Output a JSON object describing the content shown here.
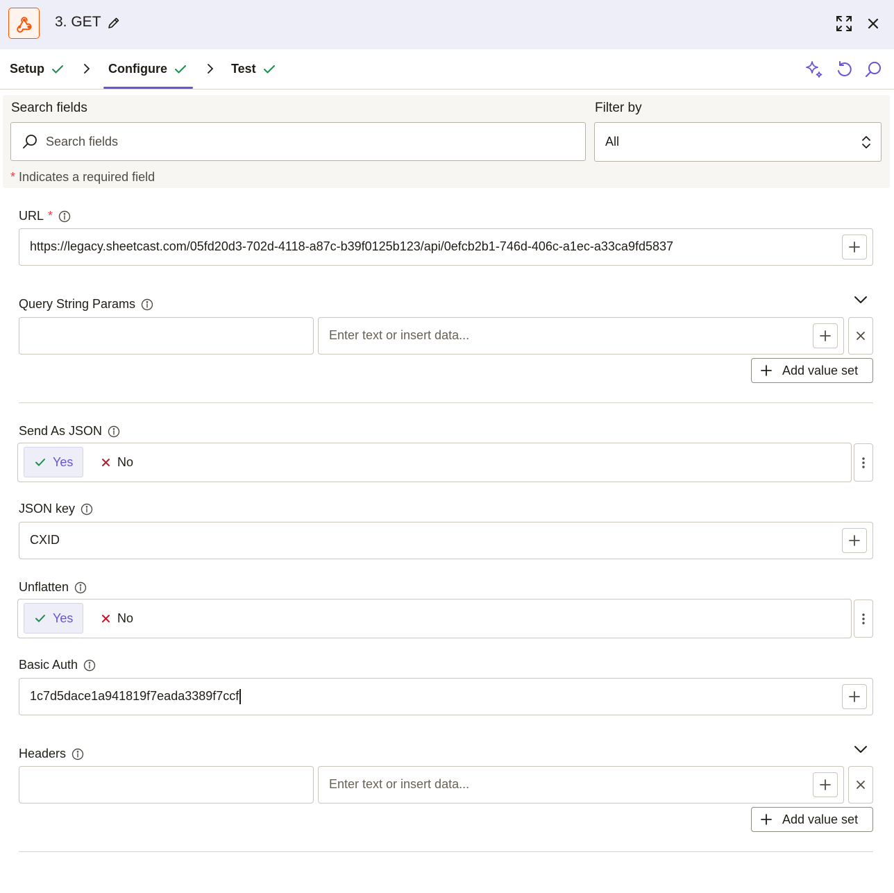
{
  "header": {
    "step_title": "3. GET",
    "app_icon": "webhook-icon",
    "edit_icon": "pencil-icon",
    "expand_icon": "expand-icon",
    "close_icon": "close-icon"
  },
  "tabs": [
    {
      "label": "Setup",
      "status_icon": "check-icon"
    },
    {
      "label": "Configure",
      "status_icon": "check-icon",
      "active": true
    },
    {
      "label": "Test",
      "status_icon": "check-icon"
    }
  ],
  "toolbar": {
    "icons": [
      "ai-sparkle-icon",
      "undo-icon",
      "search-icon"
    ]
  },
  "search_panel": {
    "search_label": "Search fields",
    "search_placeholder": "Search fields",
    "filter_label": "Filter by",
    "filter_value": "All",
    "required_note_star": "*",
    "required_note": "Indicates a required field"
  },
  "fields": {
    "url": {
      "label": "URL",
      "required_star": "*",
      "value": "https://legacy.sheetcast.com/05fd20d3-702d-4118-a87c-b39f0125b123/api/0efcb2b1-746d-406c-a1ec-a33ca9fd5837"
    },
    "query_string_params": {
      "label": "Query String Params",
      "key_value": "",
      "value_placeholder": "Enter text or insert data...",
      "add_label": "Add value set"
    },
    "send_as_json": {
      "label": "Send As JSON",
      "yes_label": "Yes",
      "no_label": "No",
      "selected": "Yes"
    },
    "json_key": {
      "label": "JSON key",
      "value": "CXID"
    },
    "unflatten": {
      "label": "Unflatten",
      "yes_label": "Yes",
      "no_label": "No",
      "selected": "Yes"
    },
    "basic_auth": {
      "label": "Basic Auth",
      "value": "1c7d5dace1a941819f7eada3389f7ccf"
    },
    "headers": {
      "label": "Headers",
      "key_value": "",
      "value_placeholder": "Enter text or insert data...",
      "add_label": "Add value set"
    }
  },
  "colors": {
    "accent": "#6754d8",
    "brand_orange": "#ff4f00",
    "check_green": "#1d8a4e",
    "no_red": "#c4162a",
    "header_bg": "#eeeef9"
  }
}
